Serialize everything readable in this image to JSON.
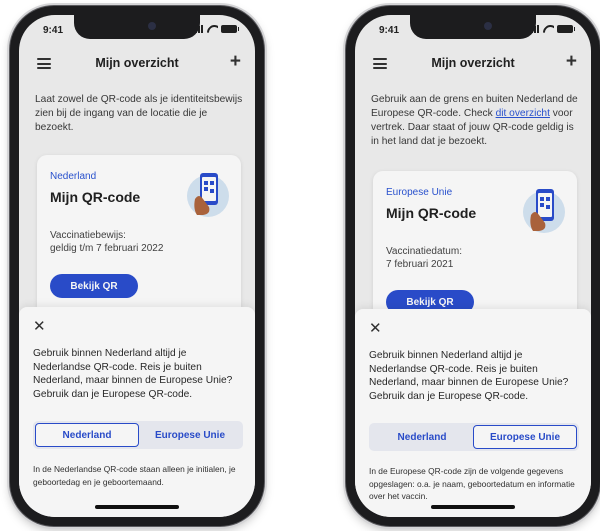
{
  "screens": [
    {
      "status_time": "9:41",
      "nav_title": "Mijn overzicht",
      "intro_parts": [
        "Laat zowel de QR-code als je identiteitsbewijs zien bij de ingang van de locatie die je bezoekt.",
        "",
        ""
      ],
      "card": {
        "region": "Nederland",
        "title": "Mijn QR-code",
        "info_line1": "Vaccinatiebewijs:",
        "info_line2": "geldig t/m 7 februari 2022",
        "button": "Bekijk QR"
      },
      "sheet": {
        "text": "Gebruik binnen Nederland altijd je Nederlandse QR-code. Reis je buiten Nederland, maar binnen de Europese Unie? Gebruik dan je Europese QR-code.",
        "tabs": [
          {
            "label": "Nederland",
            "active": true
          },
          {
            "label": "Europese Unie",
            "active": false
          }
        ],
        "footnote": "In de Nederlandse QR-code staan alleen je initialen, je geboortedag en je geboortemaand."
      }
    },
    {
      "status_time": "9:41",
      "nav_title": "Mijn overzicht",
      "intro_parts": [
        "Gebruik aan de grens en buiten Nederland de Europese QR-code. Check ",
        "dit overzicht",
        " voor vertrek. Daar staat of jouw QR-code geldig is in het land dat je bezoekt."
      ],
      "card": {
        "region": "Europese Unie",
        "title": "Mijn QR-code",
        "info_line1": "Vaccinatiedatum:",
        "info_line2": "7 februari 2021",
        "button": "Bekijk QR"
      },
      "sheet": {
        "text": "Gebruik binnen Nederland altijd je Nederlandse QR-code. Reis je buiten Nederland, maar binnen de Europese Unie? Gebruik dan je Europese QR-code.",
        "tabs": [
          {
            "label": "Nederland",
            "active": false
          },
          {
            "label": "Europese Unie",
            "active": true
          }
        ],
        "footnote": "In de Europese QR-code zijn de volgende gegevens opgeslagen: o.a. je naam, geboortedatum en informatie over het vaccin."
      }
    }
  ],
  "colors": {
    "accent": "#2b4fd1",
    "link": "#2b55d6",
    "screen_bg": "#f2f2f2",
    "illustration_circle": "#d6e6f5",
    "hand": "#b0673e"
  }
}
